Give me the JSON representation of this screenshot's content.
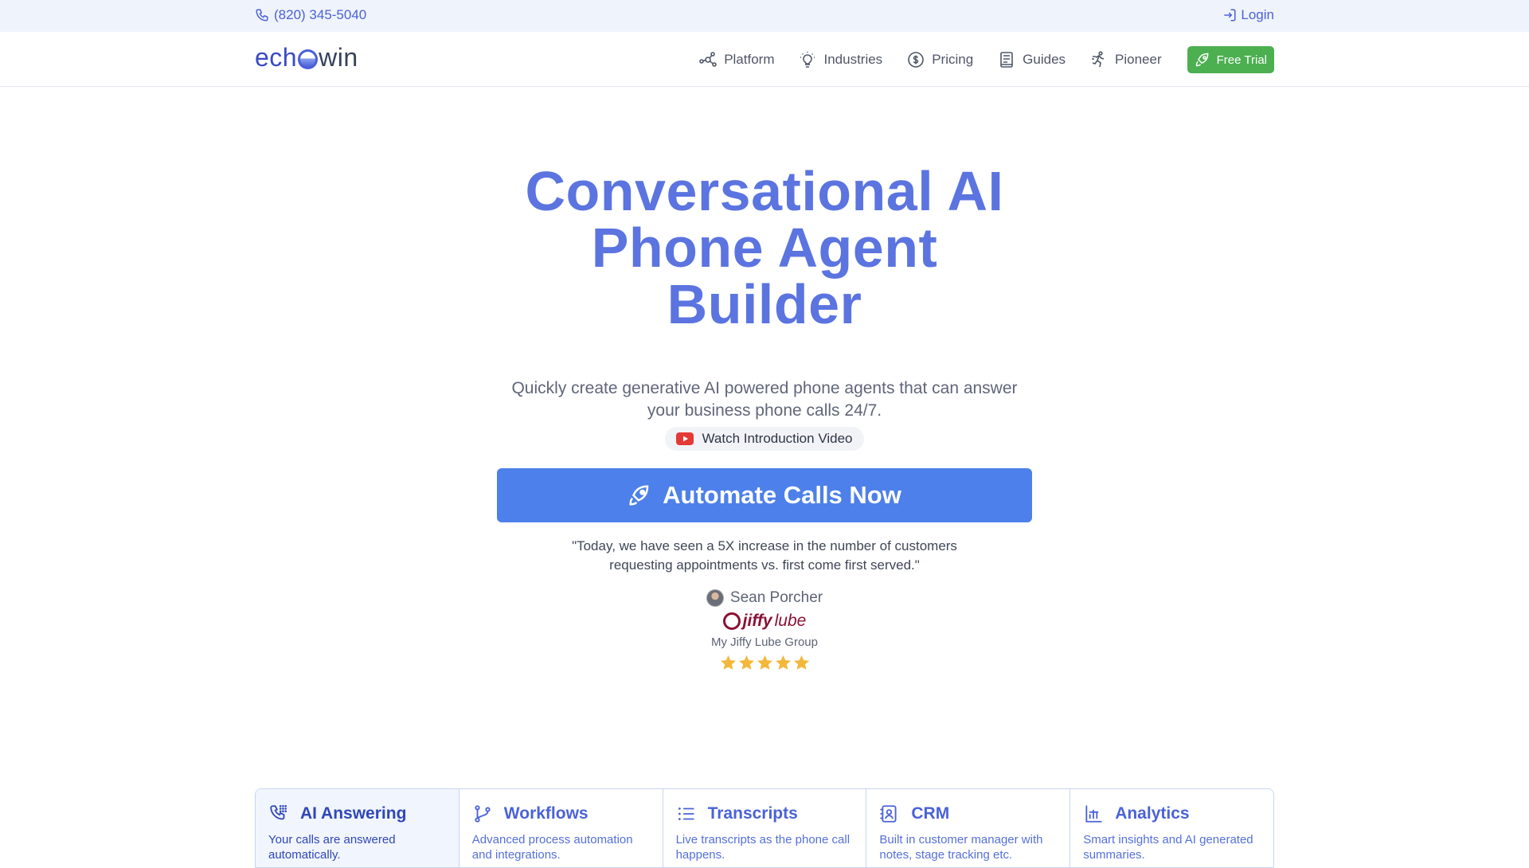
{
  "topbar": {
    "phone": "(820) 345-5040",
    "login": "Login"
  },
  "brand": {
    "logo_left": "ech",
    "logo_right": "win"
  },
  "nav": {
    "items": [
      {
        "label": "Platform",
        "icon": "network-icon"
      },
      {
        "label": "Industries",
        "icon": "lightbulb-icon"
      },
      {
        "label": "Pricing",
        "icon": "dollar-icon"
      },
      {
        "label": "Guides",
        "icon": "book-icon"
      },
      {
        "label": "Pioneer",
        "icon": "runner-icon"
      }
    ],
    "cta": "Free Trial"
  },
  "hero": {
    "title_line1": "Conversational AI",
    "title_line2": "Phone Agent",
    "title_line3": "Builder",
    "subtitle": "Quickly create generative AI powered phone agents that can answer your business phone calls 24/7.",
    "video_label": "Watch Introduction Video",
    "cta_label": "Automate Calls Now"
  },
  "testimonial": {
    "quote": "\"Today, we have seen a 5X increase in the number of customers requesting appointments vs. first come first served.\"",
    "author": "Sean Porcher",
    "logo_text_bold": "jiffy",
    "logo_text_light": "lube",
    "company": "My Jiffy Lube Group",
    "rating": 5
  },
  "features": [
    {
      "title": "AI Answering",
      "desc": "Your calls are answered automatically.",
      "icon": "phone-dialpad-icon",
      "active": true
    },
    {
      "title": "Workflows",
      "desc": "Advanced process automation and integrations.",
      "icon": "branch-icon",
      "active": false
    },
    {
      "title": "Transcripts",
      "desc": "Live transcripts as the phone call happens.",
      "icon": "list-icon",
      "active": false
    },
    {
      "title": "CRM",
      "desc": "Built in customer manager with notes, stage tracking etc.",
      "icon": "contact-card-icon",
      "active": false
    },
    {
      "title": "Analytics",
      "desc": "Smart insights and AI generated summaries.",
      "icon": "bar-chart-icon",
      "active": false
    }
  ],
  "colors": {
    "accent": "#5b74e0",
    "cta": "#4d80ea",
    "trial": "#4caf50",
    "star": "#f3b83b"
  }
}
